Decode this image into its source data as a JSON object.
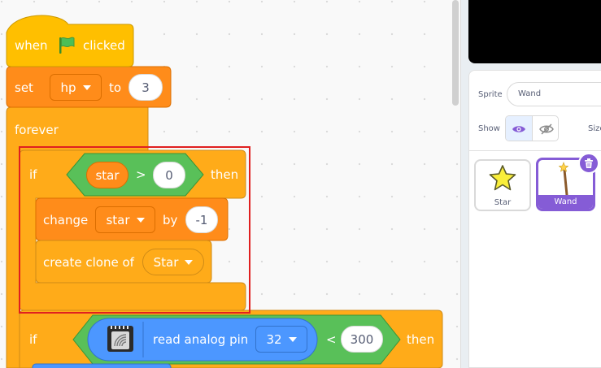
{
  "blocks": {
    "hat": {
      "when": "when",
      "flag_icon": "green-flag-icon",
      "clicked": "clicked"
    },
    "set": {
      "keyword": "set",
      "variable": "hp",
      "to": "to",
      "value": "3"
    },
    "forever": {
      "label": "forever"
    },
    "if1": {
      "if": "if",
      "variable": "star",
      "operator": ">",
      "value": "0",
      "then": "then",
      "change": {
        "keyword": "change",
        "variable": "star",
        "by": "by",
        "value": "-1"
      },
      "clone": {
        "label": "create clone of",
        "target": "Star"
      }
    },
    "if2": {
      "if": "if",
      "extension_icon": "sensor-chip-icon",
      "reporter": "read analog pin",
      "pin": "32",
      "operator": "<",
      "value": "300",
      "then": "then"
    }
  },
  "sprite_panel": {
    "sprite_label": "Sprite",
    "sprite_name": "Wand",
    "show_label": "Show",
    "size_label": "Size",
    "sprites": [
      {
        "name": "Star",
        "icon": "star-icon",
        "selected": false
      },
      {
        "name": "Wand",
        "icon": "wand-icon",
        "selected": true
      }
    ]
  },
  "colors": {
    "events": "#ffbf00",
    "variables": "#ff8c1a",
    "control": "#ffab19",
    "operators": "#59c059",
    "extension": "#4c97ff",
    "selected": "#855cd6",
    "highlight": "#e02020"
  }
}
